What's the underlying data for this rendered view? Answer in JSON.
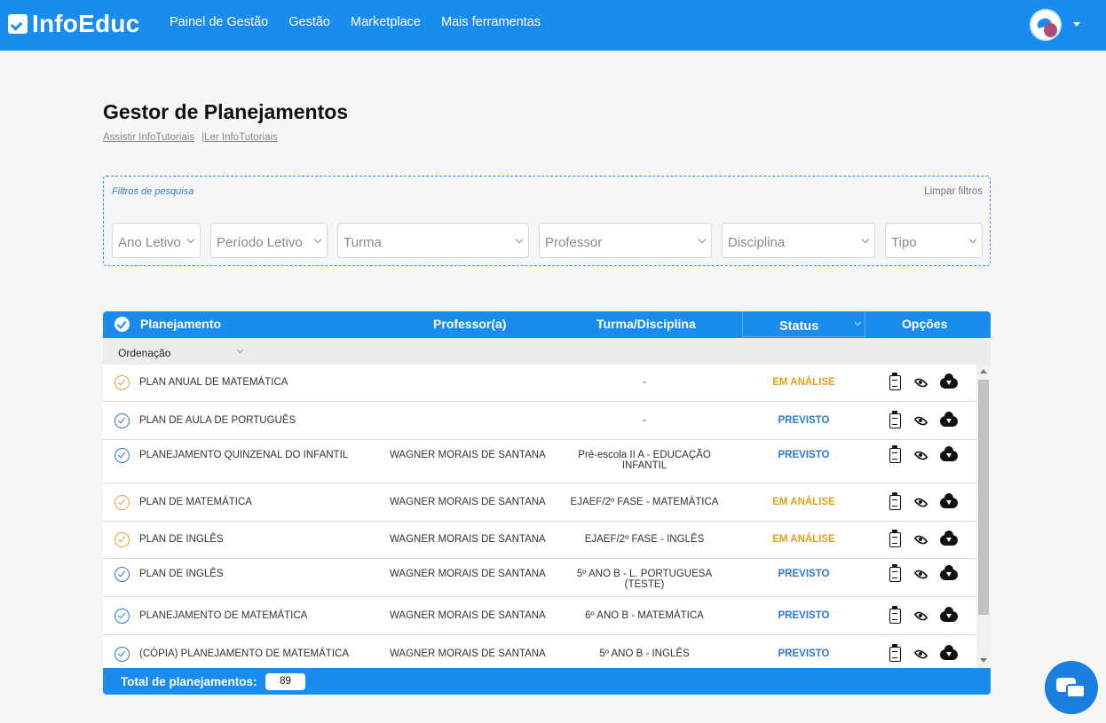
{
  "brand": {
    "name": "InfoEduc"
  },
  "nav": {
    "links": [
      "Painel de Gestão",
      "Gestão",
      "Marketplace",
      "Mais ferramentas"
    ]
  },
  "page": {
    "title": "Gestor de Planejamentos",
    "tutorial_link_1": "Assistir InfoTutoriais",
    "tutorial_sep": "|",
    "tutorial_link_2": "Ler InfoTutoriais"
  },
  "filters": {
    "label": "Filtros de pesquisa",
    "clear": "Limpar filtros",
    "selects": [
      "Ano Letivo",
      "Período Letivo",
      "Turma",
      "Professor",
      "Disciplina",
      "Tipo"
    ]
  },
  "table": {
    "headers": {
      "planejamento": "Planejamento",
      "professor": "Professor(a)",
      "turma": "Turma/Disciplina",
      "status": "Status",
      "opcoes": "Opções"
    },
    "ordering_label": "Ordenação",
    "rows": [
      {
        "title": "PLAN ANUAL DE MATEMÁTICA",
        "professor": "",
        "turma": "-",
        "status": "EM ANÁLISE",
        "status_type": "analise"
      },
      {
        "title": "PLAN DE AULA DE PORTUGUÊS",
        "professor": "",
        "turma": "-",
        "status": "PREVISTO",
        "status_type": "previsto"
      },
      {
        "title": "PLANEJAMENTO QUINZENAL DO INFANTIL",
        "professor": "WAGNER MORAIS DE SANTANA",
        "turma": "Pré-escola II A - EDUCAÇÃO INFANTIL",
        "status": "PREVISTO",
        "status_type": "previsto"
      },
      {
        "title": "PLAN DE MATEMÁTICA",
        "professor": "WAGNER MORAIS DE SANTANA",
        "turma": "EJAEF/2º FASE - MATEMÁTICA",
        "status": "EM ANÁLISE",
        "status_type": "analise"
      },
      {
        "title": "PLAN DE INGLÊS",
        "professor": "WAGNER MORAIS DE SANTANA",
        "turma": "EJAEF/2º FASE - INGLÊS",
        "status": "EM ANÁLISE",
        "status_type": "analise"
      },
      {
        "title": "PLAN DE INGLÊS",
        "professor": "WAGNER MORAIS DE SANTANA",
        "turma": "5º ANO B - L. PORTUGUESA (TESTE)",
        "status": "PREVISTO",
        "status_type": "previsto"
      },
      {
        "title": "PLANEJAMENTO DE MATEMÁTICA",
        "professor": "WAGNER MORAIS DE SANTANA",
        "turma": "6º ANO B - MATEMÁTICA",
        "status": "PREVISTO",
        "status_type": "previsto"
      },
      {
        "title": "(CÓPIA) PLANEJAMENTO DE MATEMÁTICA",
        "professor": "WAGNER MORAIS DE SANTANA",
        "turma": "5º ANO B - INGLÊS",
        "status": "PREVISTO",
        "status_type": "previsto"
      }
    ],
    "footer": {
      "total_label": "Total de planejamentos:",
      "total_count": "89"
    }
  },
  "icons": {
    "options": [
      "clipboard-icon",
      "eye-icon",
      "cloud-download-icon"
    ],
    "chat": "chat-icon"
  },
  "colors": {
    "primary": "#1a8cf0",
    "analise": "#e0a21a",
    "previsto": "#2b7ad8"
  }
}
